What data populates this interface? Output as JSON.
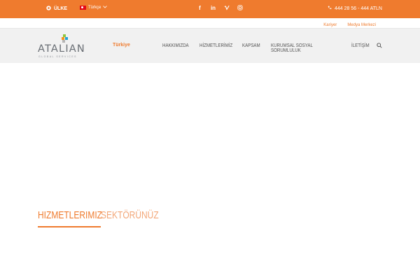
{
  "topbar": {
    "country_label": "ÜLKE",
    "language_label": "Türkçe",
    "social": [
      "f",
      "in",
      "v",
      "ig"
    ],
    "phone": "444 28 56 - 444 ATLN"
  },
  "subnav": {
    "careers": "Kariyer",
    "media": "Medya Merkezi"
  },
  "logo": {
    "name": "ATALIAN",
    "tagline": "GLOBAL SERVICES"
  },
  "region": "Türkiye",
  "menu": [
    "HAKKIMIZDA",
    "HİZMETLERİMİZ",
    "KAPSAM",
    "KURUMSAL SOSYAL SORUMLULUK",
    "İLETİŞİM"
  ],
  "tabs": {
    "active": "HIZMETLERIMIZ",
    "inactive": "SEKTÖRÜNÜZ"
  },
  "colors": {
    "accent": "#ef7b2e",
    "header_bg": "#f1f1f1"
  }
}
